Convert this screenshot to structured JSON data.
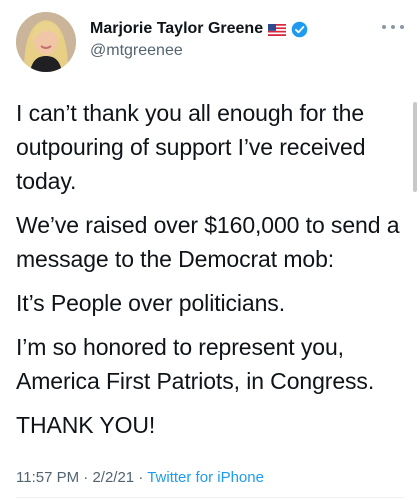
{
  "author": {
    "display_name": "Marjorie Taylor Greene",
    "handle": "@mtgreenee",
    "avatar_icon": "profile-photo",
    "badge_icons": [
      "us-flag-icon",
      "verified-badge-icon"
    ],
    "verified_color": "#1d9bf0"
  },
  "tweet": {
    "paragraphs": [
      "I can’t thank you all enough for the outpouring of support I’ve received today.",
      "We’ve raised over $160,000 to send a message to the Democrat mob:",
      "It’s People over politicians.",
      "I’m so honored to represent you, America First Patriots, in Congress.",
      "THANK YOU!"
    ],
    "time": "11:57 PM",
    "separator1": " · ",
    "date": "2/2/21",
    "separator2": " · ",
    "source": "Twitter for iPhone"
  },
  "colors": {
    "text": "#0f1419",
    "secondary": "#536471",
    "link": "#1d9bf0"
  }
}
